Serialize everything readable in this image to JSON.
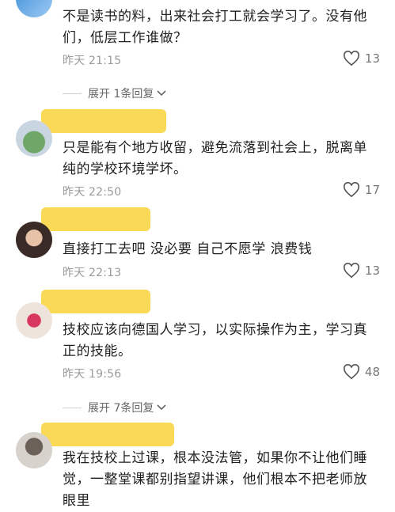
{
  "comments": [
    {
      "text": "不是读书的料，出来社会打工就会学习了。没有他们，低层工作谁做？",
      "time": "昨天 21:15",
      "likes": "13"
    },
    {
      "text": "只是能有个地方收留，避免流落到社会上，脱离单纯的学校环境学坏。",
      "time": "昨天 22:50",
      "likes": "17"
    },
    {
      "text": "直接打工去吧 没必要 自己不愿学 浪费钱",
      "time": "昨天 22:13",
      "likes": "13"
    },
    {
      "text": "技校应该向德国人学习，以实际操作为主，学习真正的技能。",
      "time": "昨天 19:56",
      "likes": "48"
    },
    {
      "text": "我在技校上过课，根本没法管，如果你不让他们睡觉，一整堂课都别指望讲课，他们根本不把老师放眼里"
    }
  ],
  "expand_replies": [
    {
      "label": "展开 1条回复"
    },
    {
      "label": "展开 7条回复"
    }
  ],
  "icons": {
    "like": "heart-icon",
    "expand": "chevron-down-icon"
  },
  "colors": {
    "highlight": "#f9d23a",
    "meta": "#9a9a9a"
  }
}
